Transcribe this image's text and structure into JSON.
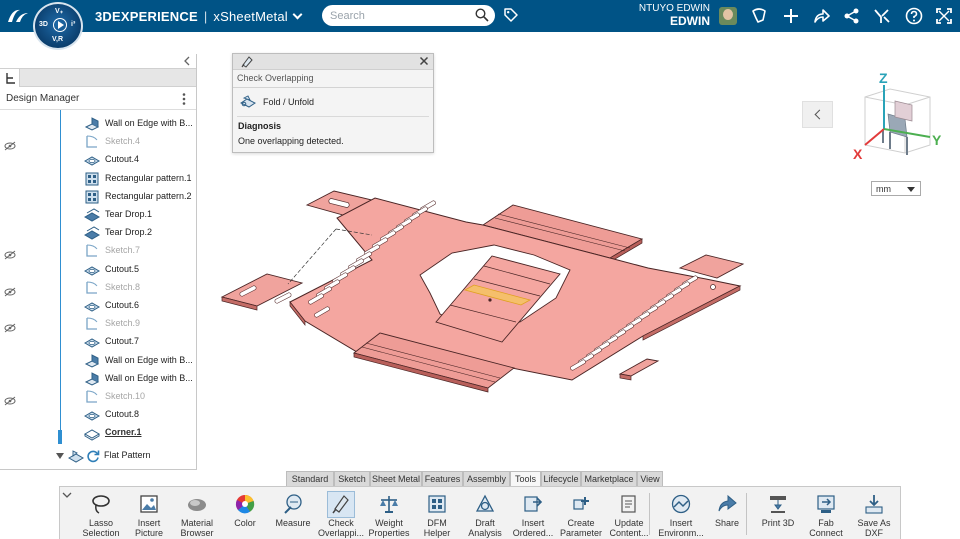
{
  "topbar": {
    "brand_bold": "3DEXPERIENCE",
    "brand_sep": "|",
    "app_name": "xSheetMetal",
    "search_placeholder": "Search",
    "user_line1": "NTUYO EDWIN",
    "user_line2": "EDWIN",
    "compass_labels": {
      "top": "V₊",
      "left": "3D",
      "right": "i³",
      "bottom": "V,R"
    },
    "brand_color": "#005386"
  },
  "left_panel": {
    "title": "Design Manager",
    "tree": [
      {
        "label": "Wall on Edge with B...",
        "kind": "wall"
      },
      {
        "label": "Sketch.4",
        "kind": "sketch"
      },
      {
        "label": "Cutout.4",
        "kind": "cutout"
      },
      {
        "label": "Rectangular pattern.1",
        "kind": "pattern"
      },
      {
        "label": "Rectangular pattern.2",
        "kind": "pattern"
      },
      {
        "label": "Tear Drop.1",
        "kind": "teardrop"
      },
      {
        "label": "Tear Drop.2",
        "kind": "teardrop"
      },
      {
        "label": "Sketch.7",
        "kind": "sketch"
      },
      {
        "label": "Cutout.5",
        "kind": "cutout"
      },
      {
        "label": "Sketch.8",
        "kind": "sketch"
      },
      {
        "label": "Cutout.6",
        "kind": "cutout"
      },
      {
        "label": "Sketch.9",
        "kind": "sketch"
      },
      {
        "label": "Cutout.7",
        "kind": "cutout"
      },
      {
        "label": "Wall on Edge with B...",
        "kind": "wall"
      },
      {
        "label": "Wall on Edge with B...",
        "kind": "wall"
      },
      {
        "label": "Sketch.10",
        "kind": "sketch"
      },
      {
        "label": "Cutout.8",
        "kind": "cutout"
      },
      {
        "label": "Corner.1",
        "kind": "corner"
      }
    ],
    "flat_pattern": "Flat Pattern"
  },
  "check_panel": {
    "title": "Check Overlapping",
    "fold_label": "Fold / Unfold",
    "diagnosis_label": "Diagnosis",
    "diagnosis_message": "One overlapping detected."
  },
  "viewport": {
    "unit": "mm",
    "axes": {
      "x": "X",
      "y": "Y",
      "z": "Z"
    },
    "part_color": "#f4a6a0",
    "overlap_color": "#f6c75a"
  },
  "tabs": [
    "Standard",
    "Sketch",
    "Sheet Metal",
    "Features",
    "Assembly",
    "Tools",
    "Lifecycle",
    "Marketplace",
    "View"
  ],
  "active_tab": "Tools",
  "tools": [
    {
      "l1": "Lasso",
      "l2": "Selection",
      "icon": "lasso-icon"
    },
    {
      "l1": "Insert",
      "l2": "Picture",
      "icon": "picture-icon"
    },
    {
      "l1": "Material",
      "l2": "Browser",
      "icon": "material-icon"
    },
    {
      "l1": "Color",
      "l2": "",
      "icon": "color-wheel-icon"
    },
    {
      "l1": "Measure",
      "l2": "",
      "icon": "measure-icon"
    },
    {
      "l1": "Check",
      "l2": "Overlappi...",
      "icon": "check-overlap-icon"
    },
    {
      "l1": "Weight",
      "l2": "Properties",
      "icon": "scale-icon"
    },
    {
      "l1": "DFM",
      "l2": "Helper",
      "icon": "dfm-icon"
    },
    {
      "l1": "Draft",
      "l2": "Analysis",
      "icon": "draft-icon"
    },
    {
      "l1": "Insert",
      "l2": "Ordered...",
      "icon": "insert-ordered-icon"
    },
    {
      "l1": "Create",
      "l2": "Parameter",
      "icon": "parameter-icon"
    },
    {
      "l1": "Update",
      "l2": "Content...",
      "icon": "update-icon"
    },
    {
      "l1": "Insert",
      "l2": "Environm...",
      "icon": "environment-icon"
    },
    {
      "l1": "Share",
      "l2": "",
      "icon": "share-icon"
    },
    {
      "l1": "Print 3D",
      "l2": "",
      "icon": "print3d-icon"
    },
    {
      "l1": "Fab",
      "l2": "Connect",
      "icon": "fab-connect-icon"
    },
    {
      "l1": "Save As",
      "l2": "DXF",
      "icon": "save-dxf-icon"
    }
  ]
}
